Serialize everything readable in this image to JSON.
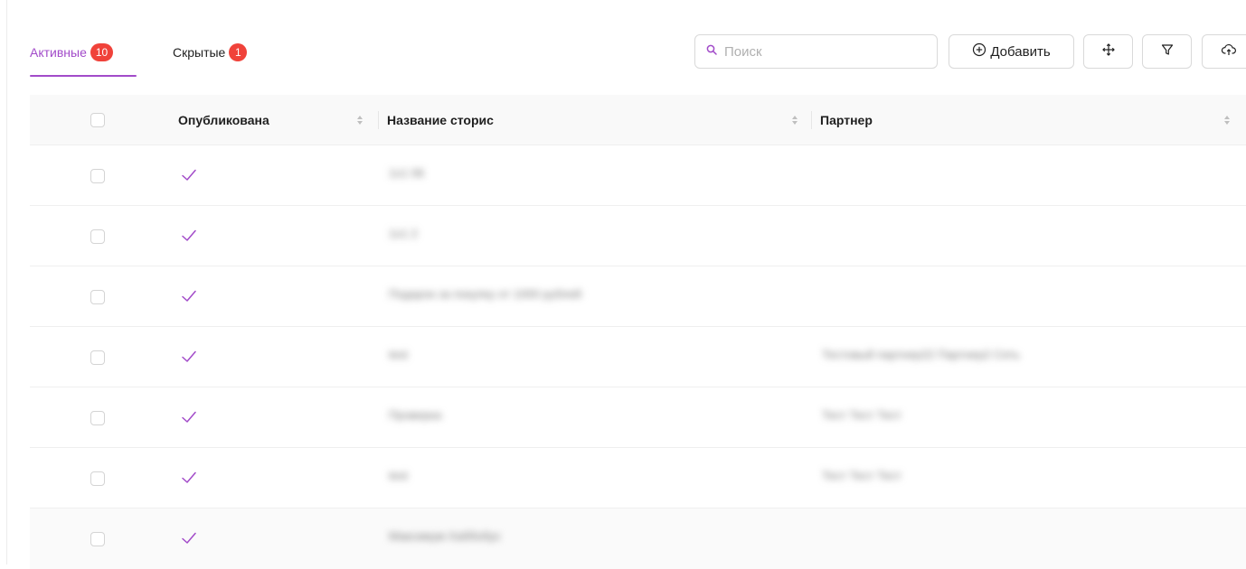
{
  "tabs": [
    {
      "label": "Активные",
      "count": "10"
    },
    {
      "label": "Скрытые",
      "count": "1"
    }
  ],
  "toolbar": {
    "search_placeholder": "Поиск",
    "add_label": "Добавить"
  },
  "table": {
    "columns": [
      "Опубликована",
      "Название сторис",
      "Партнер"
    ],
    "rows": [
      {
        "published": true,
        "title": "1x1 06",
        "partner": ""
      },
      {
        "published": true,
        "title": "1x1 2",
        "partner": ""
      },
      {
        "published": true,
        "title": "Подарок за покупку от 1000 рублей",
        "partner": ""
      },
      {
        "published": true,
        "title": "test",
        "partner": "Тестовый партнер22 Партнер2 Сеть"
      },
      {
        "published": true,
        "title": "Проверка",
        "partner": "Тест Тест Тест"
      },
      {
        "published": true,
        "title": "test",
        "partner": "Тест Тест Тест"
      },
      {
        "published": true,
        "title": "Максимум Хаббобус",
        "partner": ""
      }
    ]
  },
  "colors": {
    "accent": "#a24bc9",
    "badge": "#f0423a",
    "border": "#d9d9d9",
    "header_bg": "#f9f9f9"
  },
  "icons": [
    "search-icon",
    "plus-circle-icon",
    "move-icon",
    "filter-icon",
    "cloud-upload-icon",
    "sort-icon",
    "check-icon"
  ]
}
